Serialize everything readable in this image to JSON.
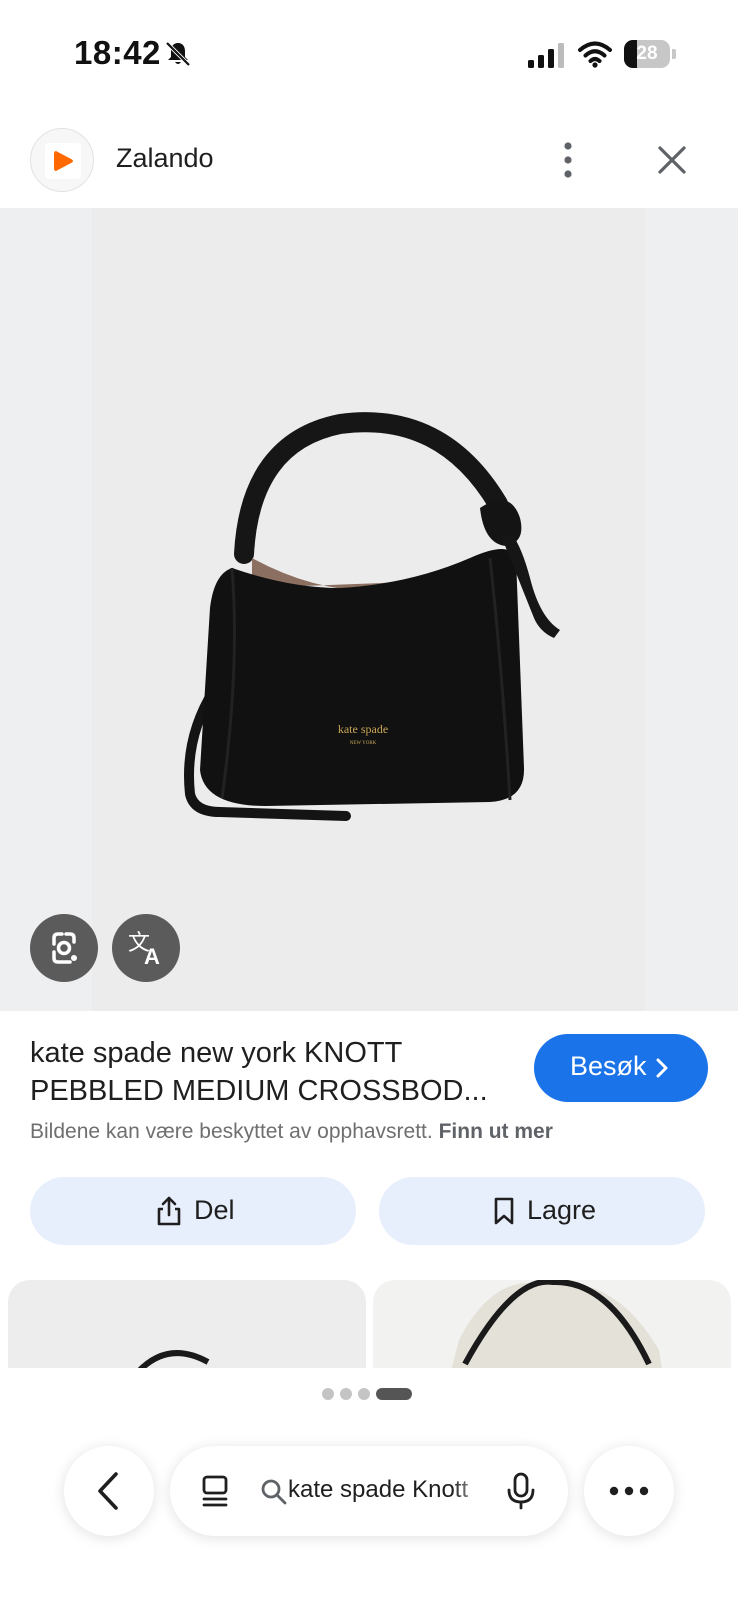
{
  "status_bar": {
    "time": "18:42",
    "battery_level": "28",
    "battery_fraction": 0.28,
    "icons": [
      "bell-slash-icon",
      "cellular-signal-icon",
      "wifi-icon",
      "battery-icon"
    ]
  },
  "source": {
    "name": "Zalando",
    "logo_color": "#ff6900",
    "icons": [
      "zalando-logo",
      "more-vert-icon",
      "close-icon"
    ]
  },
  "hero": {
    "brand_print": "kate spade",
    "brand_print_sub": "NEW YORK",
    "icons": [
      "google-lens-icon",
      "translate-icon"
    ]
  },
  "product": {
    "title_line1": "kate spade new york KNOTT",
    "title_line2": "PEBBLED MEDIUM CROSSBOD...",
    "visit_label": "Besøk",
    "copyright_text": "Bildene kan være beskyttet av opphavsrett.",
    "copyright_link": "Finn ut mer"
  },
  "actions": {
    "share_label": "Del",
    "save_label": "Lagre"
  },
  "pager": {
    "count": 4,
    "active_index": 3
  },
  "search": {
    "query": "kate spade Knott"
  },
  "colors": {
    "accent": "#1a73e8",
    "pill_bg": "#e8effc",
    "overlay_btn": "#5b5b5b"
  }
}
